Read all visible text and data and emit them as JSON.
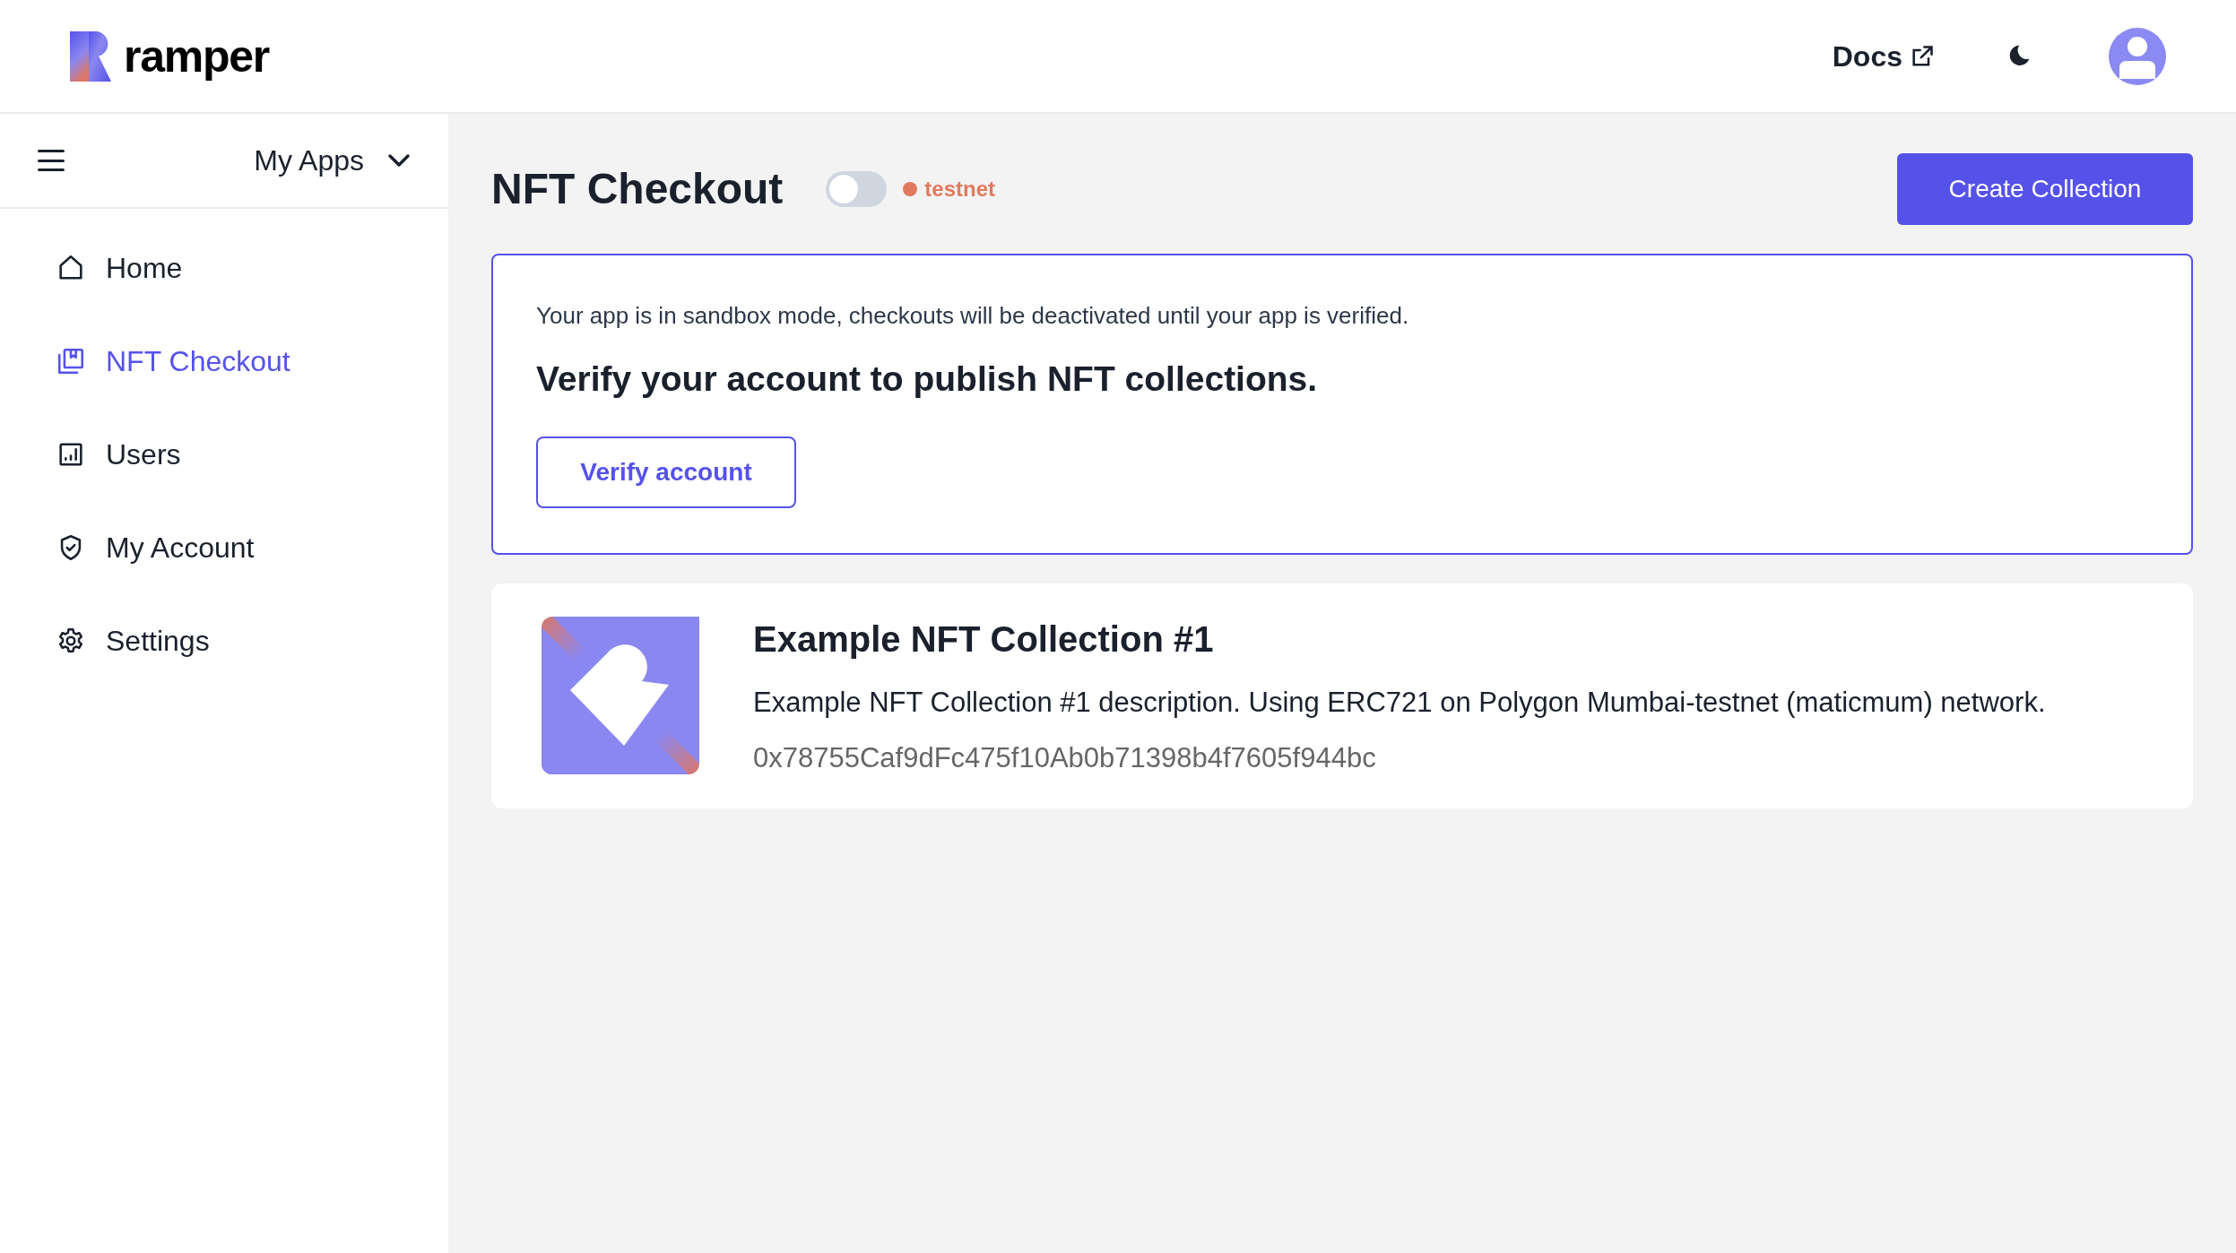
{
  "header": {
    "logo_text": "ramper",
    "docs_link": "Docs"
  },
  "sidebar": {
    "app_selector": "My Apps",
    "items": [
      {
        "label": "Home",
        "selected": false
      },
      {
        "label": "NFT Checkout",
        "selected": true
      },
      {
        "label": "Users",
        "selected": false
      },
      {
        "label": "My Account",
        "selected": false
      },
      {
        "label": "Settings",
        "selected": false
      }
    ]
  },
  "page": {
    "title": "NFT Checkout",
    "live_toggle": {
      "on": false
    },
    "network_badge": {
      "label": "testnet",
      "color": "#e07a5f"
    },
    "create_button": "Create Collection"
  },
  "banner": {
    "message": "Your app is in sandbox mode, checkouts will be deactivated until your app is verified.",
    "heading": "Verify your account to publish NFT collections.",
    "button": "Verify account"
  },
  "collections": [
    {
      "name": "Example NFT Collection #1",
      "description": "Example NFT Collection #1 description. Using ERC721 on Polygon Mumbai-testnet (maticmum) network.",
      "address": "0x78755Caf9dFc475f10Ab0b71398b4f7605f944bc"
    }
  ]
}
